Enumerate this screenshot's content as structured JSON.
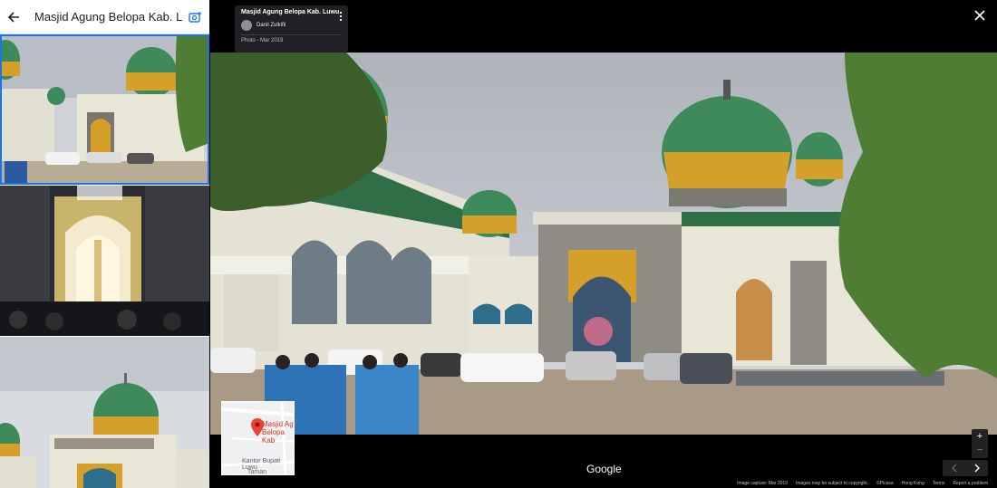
{
  "left_panel": {
    "title": "Masjid Agung Belopa Kab. Luwu"
  },
  "viewer": {
    "info_card": {
      "title": "Masjid Agung Belopa Kab. Luwu",
      "author": "Danil Zulkifli",
      "date": "Photo - Mar 2019"
    },
    "minimap": {
      "place_line1": "Masjid Ag",
      "place_line2": "Belopa Kab",
      "poi": "Kantor Bupati Luwu",
      "poi2": "Taman"
    },
    "logo": "Google",
    "zoom_in": "+",
    "zoom_out": "−",
    "footer": {
      "capture": "Image capture: Mar 2019",
      "copyright": "Images may be subject to copyright.",
      "picasa": "©Picasa",
      "region": "Hong Kong",
      "terms": "Terms",
      "report": "Report a problem"
    }
  },
  "colors": {
    "accent_blue": "#1a73e8",
    "dome_green": "#3f8a5a",
    "dome_gold": "#d4a02a",
    "wall_cream": "#e8e6d6",
    "roof_green": "#2f6e46",
    "sky": "#c9ccd0"
  },
  "icons": [
    "back-arrow-icon",
    "add-photo-icon",
    "chevron-left-icon",
    "more-vert-icon",
    "close-icon",
    "map-pin-icon",
    "chevron-right-icon"
  ]
}
